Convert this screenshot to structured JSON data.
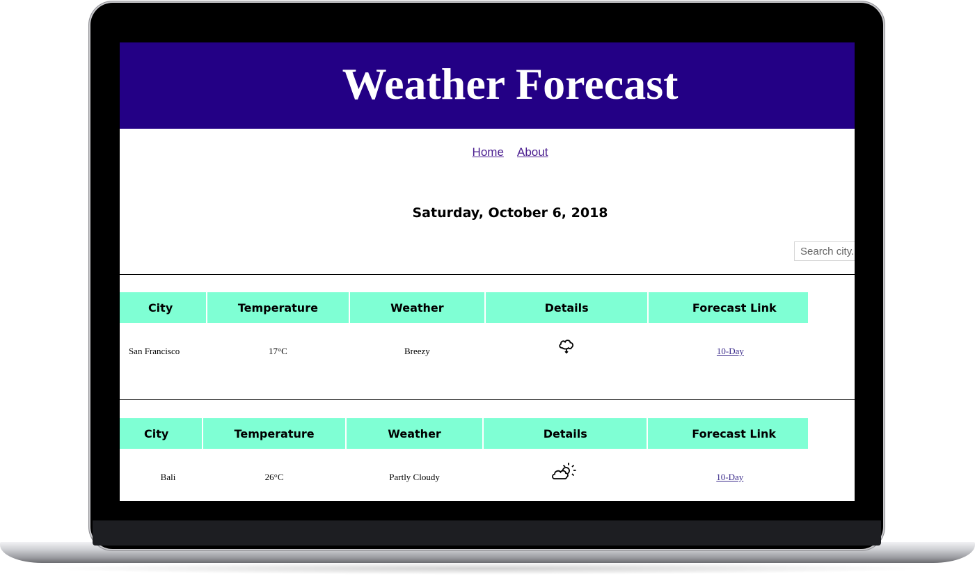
{
  "header": {
    "title": "Weather Forecast"
  },
  "nav": {
    "home": "Home",
    "about": "About"
  },
  "date": "Saturday, October 6, 2018",
  "search": {
    "placeholder": "Search city..."
  },
  "columns": {
    "city": "City",
    "temperature": "Temperature",
    "weather": "Weather",
    "details": "Details",
    "forecast": "Forecast Link"
  },
  "rows": [
    {
      "city": "San Francisco",
      "temperature": "17°C",
      "weather": "Breezy",
      "icon": "breezy-icon",
      "forecast_link": "10-Day"
    },
    {
      "city": "Bali",
      "temperature": "26°C",
      "weather": "Partly Cloudy",
      "icon": "partly-cloudy-icon",
      "forecast_link": "10-Day"
    }
  ],
  "colors": {
    "banner": "#230085",
    "table_header": "#7fffd4",
    "link": "#4a1d8f"
  }
}
